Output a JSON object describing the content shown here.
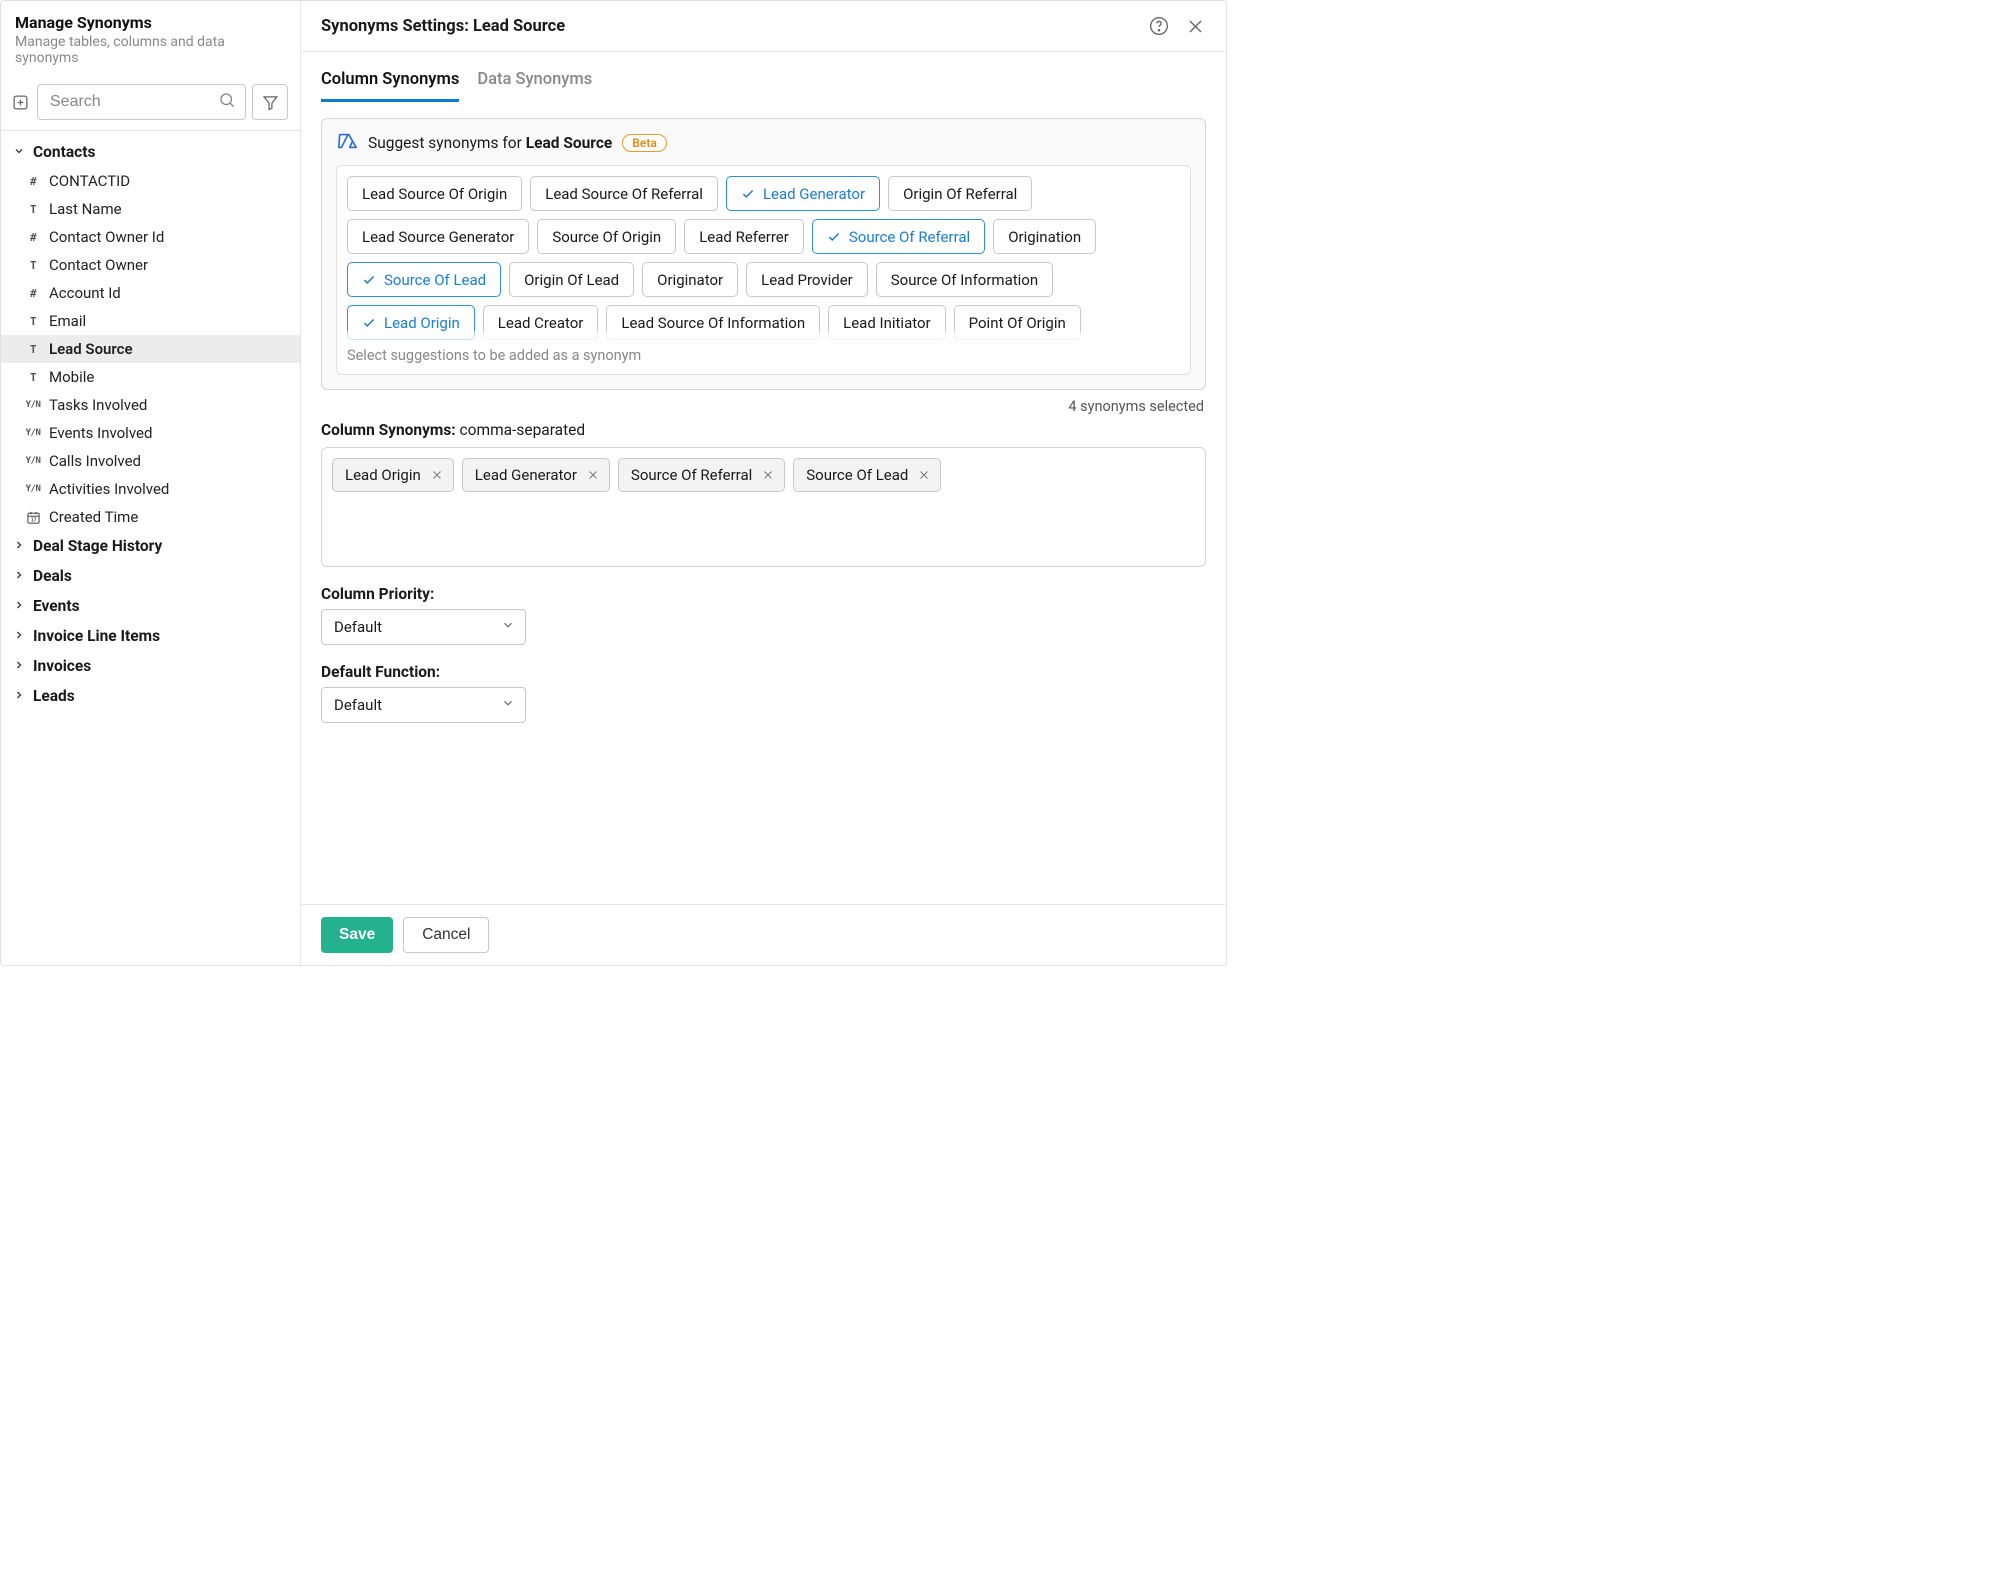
{
  "leftPanel": {
    "title": "Manage Synonyms",
    "subtitle": "Manage tables, columns and data synonyms",
    "searchPlaceholder": "Search",
    "tree": {
      "expandedGroup": {
        "label": "Contacts",
        "items": [
          {
            "type": "hash",
            "label": "CONTACTID",
            "selected": false
          },
          {
            "type": "text",
            "label": "Last Name",
            "selected": false
          },
          {
            "type": "hash",
            "label": "Contact Owner Id",
            "selected": false
          },
          {
            "type": "text",
            "label": "Contact Owner",
            "selected": false
          },
          {
            "type": "hash",
            "label": "Account Id",
            "selected": false
          },
          {
            "type": "text",
            "label": "Email",
            "selected": false
          },
          {
            "type": "text",
            "label": "Lead Source",
            "selected": true
          },
          {
            "type": "text",
            "label": "Mobile",
            "selected": false
          },
          {
            "type": "yn",
            "label": "Tasks Involved",
            "selected": false
          },
          {
            "type": "yn",
            "label": "Events Involved",
            "selected": false
          },
          {
            "type": "yn",
            "label": "Calls Involved",
            "selected": false
          },
          {
            "type": "yn",
            "label": "Activities Involved",
            "selected": false
          },
          {
            "type": "date",
            "label": "Created Time",
            "selected": false
          }
        ]
      },
      "collapsedGroups": [
        "Deal Stage History",
        "Deals",
        "Events",
        "Invoice Line Items",
        "Invoices",
        "Leads"
      ]
    }
  },
  "rightPanel": {
    "titlePrefix": "Synonyms Settings: ",
    "titleEntity": "Lead Source",
    "tabs": [
      {
        "label": "Column Synonyms",
        "active": true
      },
      {
        "label": "Data Synonyms",
        "active": false
      }
    ],
    "suggest": {
      "textPrefix": "Suggest synonyms for ",
      "textStrong": "Lead Source",
      "betaLabel": "Beta",
      "chips": [
        {
          "label": "Lead Source Of Origin",
          "selected": false
        },
        {
          "label": "Lead Source Of Referral",
          "selected": false
        },
        {
          "label": "Lead Generator",
          "selected": true
        },
        {
          "label": "Origin Of Referral",
          "selected": false
        },
        {
          "label": "Lead Source Generator",
          "selected": false
        },
        {
          "label": "Source Of Origin",
          "selected": false
        },
        {
          "label": "Lead Referrer",
          "selected": false
        },
        {
          "label": "Source Of Referral",
          "selected": true
        },
        {
          "label": "Origination",
          "selected": false
        },
        {
          "label": "Source Of Lead",
          "selected": true
        },
        {
          "label": "Origin Of Lead",
          "selected": false
        },
        {
          "label": "Originator",
          "selected": false
        },
        {
          "label": "Lead Provider",
          "selected": false
        },
        {
          "label": "Source Of Information",
          "selected": false
        },
        {
          "label": "Lead Origin",
          "selected": true
        },
        {
          "label": "Lead Creator",
          "selected": false
        },
        {
          "label": "Lead Source Of Information",
          "selected": false
        },
        {
          "label": "Lead Initiator",
          "selected": false
        },
        {
          "label": "Point Of Origin",
          "selected": false
        }
      ],
      "footerText": "Select suggestions to be added as a synonym"
    },
    "selectedCount": "4 synonyms selected",
    "columnSynonymsLabelStrong": "Column Synonyms:",
    "columnSynonymsLabelRest": " comma-separated",
    "selectedChips": [
      "Lead Origin",
      "Lead Generator",
      "Source Of Referral",
      "Source Of Lead"
    ],
    "priority": {
      "label": "Column Priority:",
      "value": "Default"
    },
    "defaultFunction": {
      "label": "Default Function:",
      "value": "Default"
    },
    "footer": {
      "save": "Save",
      "cancel": "Cancel"
    }
  }
}
